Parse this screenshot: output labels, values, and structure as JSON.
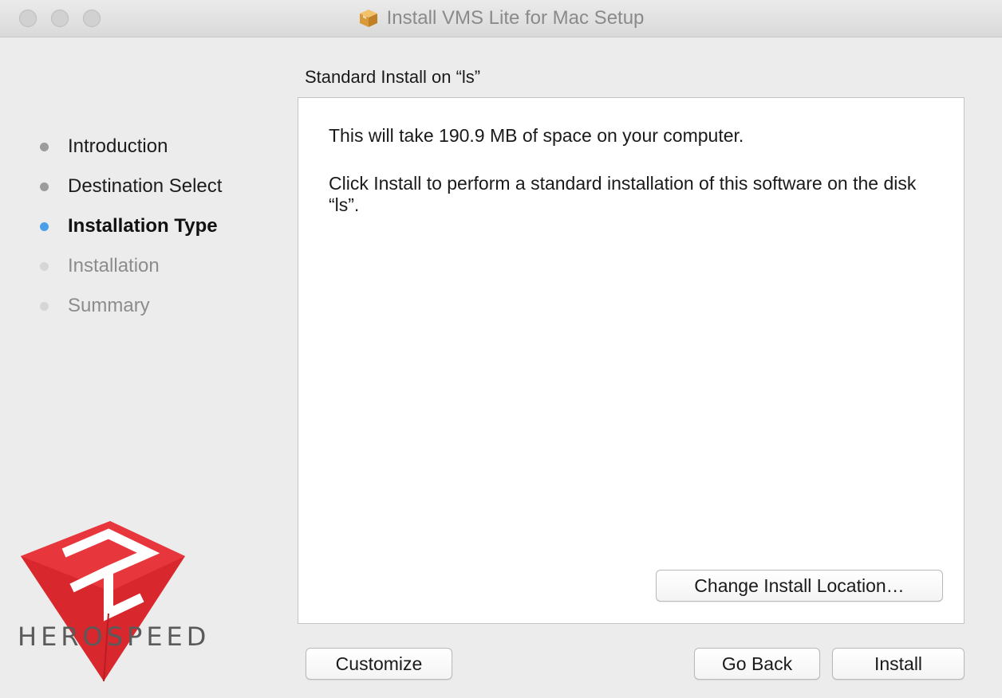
{
  "window": {
    "title": "Install VMS Lite for Mac Setup",
    "icon": "package-icon"
  },
  "sidebar": {
    "steps": [
      {
        "label": "Introduction",
        "state": "done"
      },
      {
        "label": "Destination Select",
        "state": "done"
      },
      {
        "label": "Installation Type",
        "state": "current"
      },
      {
        "label": "Installation",
        "state": "future"
      },
      {
        "label": "Summary",
        "state": "future"
      }
    ],
    "logo": {
      "text": "HEROSPEED",
      "icon": "herospeed-logo-icon",
      "color": "#d9272e"
    }
  },
  "main": {
    "section_title": "Standard Install on “ls”",
    "line1": "This will take 190.9 MB of space on your computer.",
    "line2": "Click Install to perform a standard installation of this software on the disk “ls”.",
    "change_location_label": "Change Install Location…"
  },
  "footer": {
    "customize_label": "Customize",
    "go_back_label": "Go Back",
    "install_label": "Install"
  },
  "colors": {
    "current_step": "#4a9fe8",
    "done_step": "#9c9c9c",
    "future_step": "#d6d6d6",
    "brand_red": "#d9272e"
  }
}
